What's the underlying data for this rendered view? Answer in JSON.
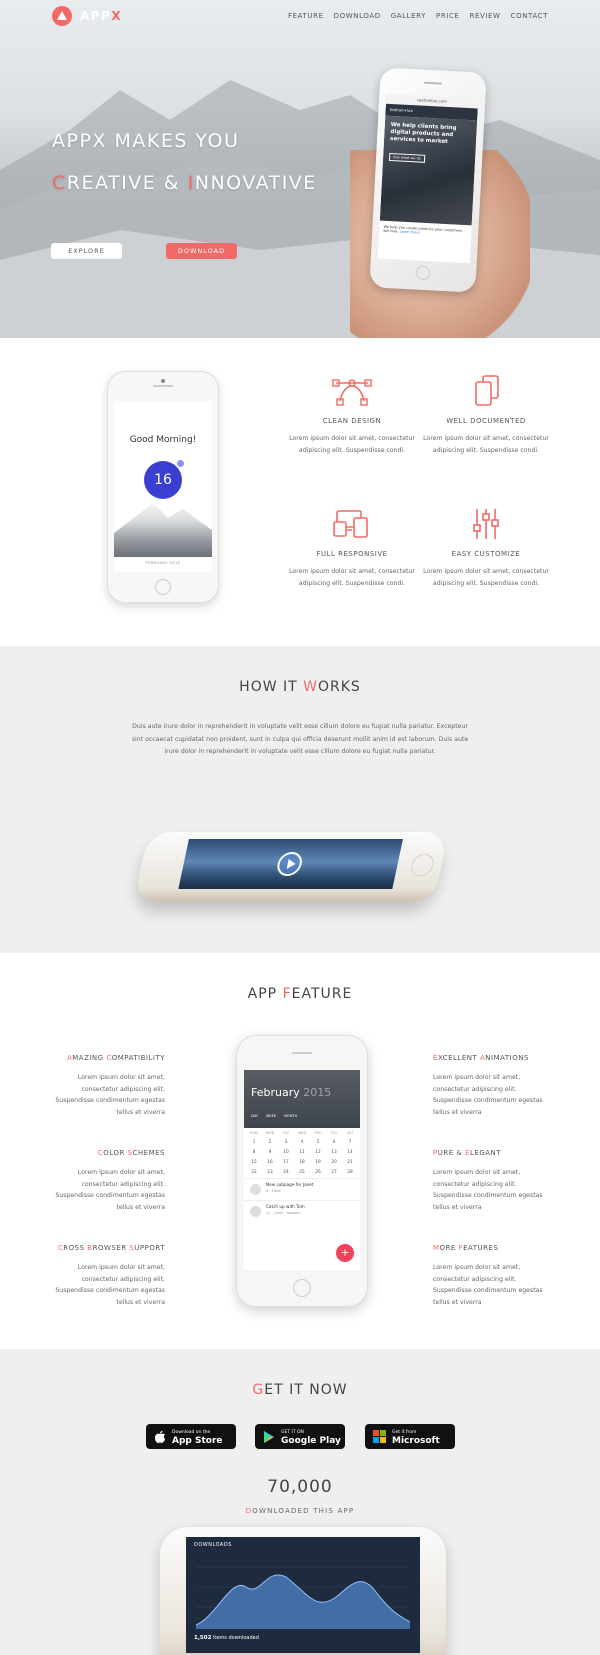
{
  "brand": {
    "name_a": "APP",
    "name_b": "X"
  },
  "nav": [
    "FEATURE",
    "DOWNLOAD",
    "GALLERY",
    "PRICE",
    "REVIEW",
    "CONTACT"
  ],
  "hero": {
    "line1": "APPX MAKES YOU",
    "line2_c": "C",
    "line2_a": "REATIVE & ",
    "line2_i": "I",
    "line2_b": "NNOVATIVE",
    "explore": "EXPLORE",
    "download": "DOWNLOAD",
    "phone": {
      "url": "teehanlax.com",
      "site": "teehan+lax",
      "headline": "We help clients bring digital products and services to market",
      "cta": "See what we do",
      "foot": "We help you create products your customers will love.",
      "foot_link": "Learn more"
    }
  },
  "features": {
    "phone": {
      "greeting": "Good Morning!",
      "day": "16",
      "date": "FEBRUARY 2015"
    },
    "items": [
      {
        "title": "CLEAN DESIGN",
        "text": "Lorem ipsum dolor sit amet, consectetur adipiscing elit. Suspendisse condi."
      },
      {
        "title": "WELL DOCUMENTED",
        "text": "Lorem ipsum dolor sit amet, consectetur adipiscing elit. Suspendisse condi."
      },
      {
        "title": "FULL RESPONSIVE",
        "text": "Lorem ipsum dolor sit amet, consectetur adipiscing elit. Suspendisse condi."
      },
      {
        "title": "EASY CUSTOMIZE",
        "text": "Lorem ipsum dolor sit amet, consectetur adipiscing elit. Suspendisse condi."
      }
    ]
  },
  "how": {
    "title_a": "HOW IT ",
    "title_w": "W",
    "title_b": "ORKS",
    "text": "Duis aute irure dolor in reprehenderit in voluptate velit esse cillum dolore eu fugiat nulla pariatur. Excepteur sint occaecat cupidatat non proident, sunt in culpa qui officia deserunt mollit anim id est laborum. Duis aute irure dolor in reprehenderit in voluptate velit esse cillum dolore eu fugiat nulla pariatur."
  },
  "app_feature": {
    "title_a": "APP ",
    "title_f": "F",
    "title_b": "EATURE",
    "text": "Lorem ipsum dolor sit amet, consectetur adipiscing elit. Suspendisse condimentum egestas tellus et viverra",
    "left": [
      {
        "l1": "A",
        "w1": "MAZING ",
        "l2": "C",
        "w2": "OMPATIBILITY"
      },
      {
        "l1": "C",
        "w1": "OLOR ",
        "l2": "S",
        "w2": "CHEMES"
      },
      {
        "l1": "C",
        "w1": "ROSS ",
        "l2": "B",
        "w2": "ROWSER ",
        "l3": "S",
        "w3": "UPPORT"
      }
    ],
    "right": [
      {
        "l1": "E",
        "w1": "XCELLENT ",
        "l2": "A",
        "w2": "NIMATIONS"
      },
      {
        "l1": "P",
        "w1": "URE & ",
        "l2": "E",
        "w2": "LEGANT"
      },
      {
        "l1": "M",
        "w1": "ORE ",
        "l2": "F",
        "w2": "EATURES"
      }
    ],
    "calendar": {
      "month": "February",
      "year": "2015",
      "tabs": [
        "DAY",
        "WEEK",
        "MONTH"
      ],
      "weekdays": [
        "SUN",
        "MON",
        "TUE",
        "WED",
        "THU",
        "FRI",
        "SAT"
      ],
      "days": [
        "1",
        "2",
        "3",
        "4",
        "5",
        "6",
        "7",
        "8",
        "9",
        "10",
        "11",
        "12",
        "13",
        "14",
        "15",
        "16",
        "17",
        "18",
        "19",
        "20",
        "21",
        "22",
        "23",
        "24",
        "25",
        "26",
        "27",
        "28"
      ],
      "events": [
        {
          "title": "New subpage for Janet",
          "time": "8 - 10am"
        },
        {
          "title": "Catch up with Tom",
          "time": "11 - 12am · Yasapon"
        }
      ]
    }
  },
  "getit": {
    "title_g": "G",
    "title_a": "ET IT NOW",
    "stores": [
      {
        "small": "Download on the",
        "big": "App Store"
      },
      {
        "small": "GET IT ON",
        "big": "Google Play"
      },
      {
        "small": "Get it from",
        "big": "Microsoft"
      }
    ],
    "count": "70,000",
    "label_d": "D",
    "label_a": "OWNLOADED THIS APP",
    "phone": {
      "title": "DOWNLOADS",
      "stat": "1,502",
      "stat_label": "items downloaded"
    }
  },
  "colors": {
    "accent": "#f26a67",
    "grey_bg": "#efefef"
  }
}
